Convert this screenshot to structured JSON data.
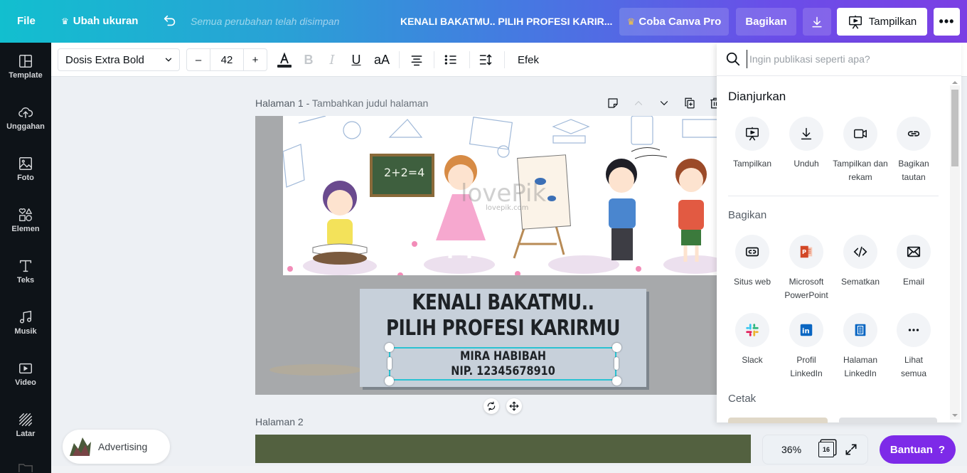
{
  "topbar": {
    "file": "File",
    "resize": "Ubah ukuran",
    "saved_status": "Semua perubahan telah disimpan",
    "doc_title": "KENALI BAKATMU.. PILIH PROFESI KARIR...",
    "try_pro": "Coba Canva Pro",
    "share": "Bagikan",
    "present": "Tampilkan",
    "more": "•••"
  },
  "sidebar": {
    "items": [
      {
        "label": "Template",
        "icon": "template-icon"
      },
      {
        "label": "Unggahan",
        "icon": "upload-cloud-icon"
      },
      {
        "label": "Foto",
        "icon": "photo-icon"
      },
      {
        "label": "Elemen",
        "icon": "elements-icon"
      },
      {
        "label": "Teks",
        "icon": "text-icon"
      },
      {
        "label": "Musik",
        "icon": "music-icon"
      },
      {
        "label": "Video",
        "icon": "video-icon"
      },
      {
        "label": "Latar",
        "icon": "background-icon"
      }
    ]
  },
  "toolbar": {
    "font": "Dosis Extra Bold",
    "size_minus": "–",
    "font_size": "42",
    "size_plus": "+",
    "case_toggle": "aA",
    "effects": "Efek"
  },
  "canvas": {
    "page1_label": "Halaman 1 - ",
    "page1_title_placeholder": "Tambahkan judul halaman",
    "page2_label": "Halaman 2",
    "design": {
      "title_line1": "KENALI BAKATMU..",
      "title_line2": "PILIH PROFESI KARIRMU",
      "name": "MIRA HABIBAH",
      "nip": "NIP. 12345678910",
      "blackboard": "2+2=4",
      "watermark": "lovePik",
      "watermark_url": "lovepik.com"
    }
  },
  "ad": {
    "label": "Advertising"
  },
  "publish_panel": {
    "search_placeholder": "Ingin publikasi seperti apa?",
    "sections": {
      "recommended": "Dianjurkan",
      "share": "Bagikan",
      "print": "Cetak"
    },
    "recommended": [
      {
        "label": "Tampilkan",
        "icon": "present-icon"
      },
      {
        "label": "Unduh",
        "icon": "download-icon"
      },
      {
        "label": "Tampilkan dan rekam",
        "icon": "record-camera-icon"
      },
      {
        "label": "Bagikan tautan",
        "icon": "link-icon"
      }
    ],
    "share": [
      {
        "label": "Situs web",
        "icon": "website-icon"
      },
      {
        "label": "Microsoft PowerPoint",
        "icon": "powerpoint-icon"
      },
      {
        "label": "Sematkan",
        "icon": "embed-code-icon"
      },
      {
        "label": "Email",
        "icon": "email-icon"
      },
      {
        "label": "Slack",
        "icon": "slack-icon"
      },
      {
        "label": "Profil LinkedIn",
        "icon": "linkedin-icon"
      },
      {
        "label": "Halaman LinkedIn",
        "icon": "linkedin-page-icon"
      },
      {
        "label": "Lihat semua",
        "icon": "more-dots-icon"
      }
    ]
  },
  "footer": {
    "zoom": "36%",
    "page_count": "16",
    "help": "Bantuan",
    "help_icon": "?"
  },
  "colors": {
    "accent_purple": "#7d2ae8",
    "selection_cyan": "#2bc2d2",
    "sidebar_bg": "#0e1318",
    "page2_bg": "#536140",
    "title_box_bg": "#c7d0da"
  }
}
